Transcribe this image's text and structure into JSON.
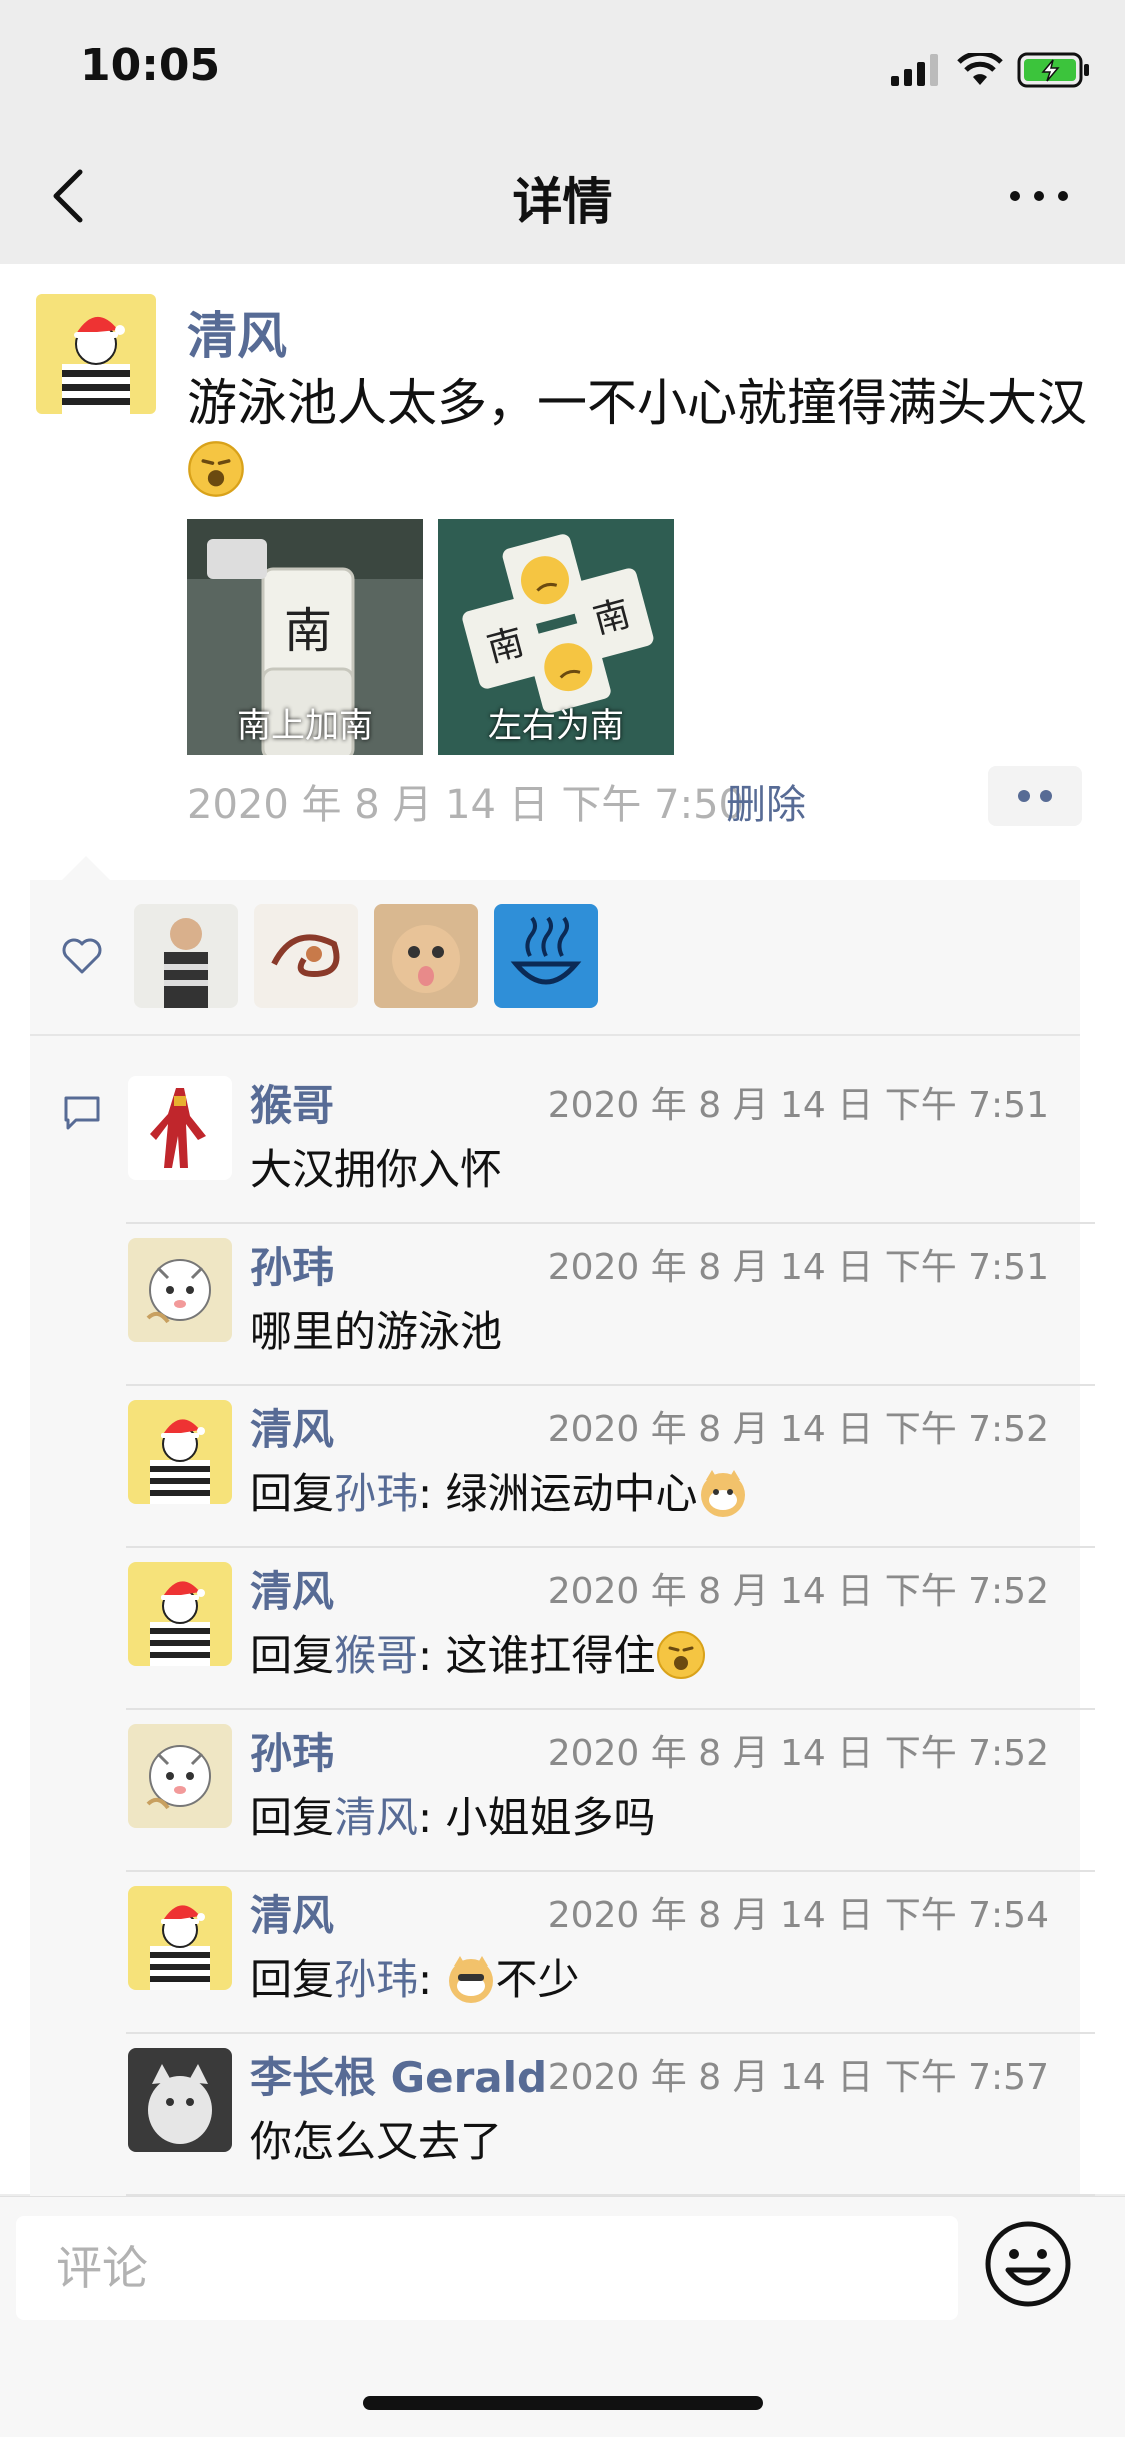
{
  "status_bar": {
    "time": "10:05"
  },
  "nav": {
    "title": "详情"
  },
  "post": {
    "author": "清风",
    "text": "游泳池人太多，一不小心就撞得满头大汉",
    "images": [
      {
        "caption": "南上加南"
      },
      {
        "caption": "左右为南"
      }
    ],
    "time": "2020 年 8 月 14 日  下午 7:50",
    "delete_label": "删除"
  },
  "likes": {
    "users": [
      "user-1",
      "user-2",
      "user-3",
      "user-4"
    ]
  },
  "comments": [
    {
      "name": "猴哥",
      "time": "2020 年 8 月 14 日  下午 7:51",
      "text": "大汉拥你入怀"
    },
    {
      "name": "孙玮",
      "time": "2020 年 8 月 14 日  下午 7:51",
      "text": "哪里的游泳池"
    },
    {
      "name": "清风",
      "time": "2020 年 8 月 14 日  下午 7:52",
      "prefix": "回复",
      "reply_to": "孙玮",
      "text": ": 绿洲运动中心"
    },
    {
      "name": "清风",
      "time": "2020 年 8 月 14 日  下午 7:52",
      "prefix": "回复",
      "reply_to": "猴哥",
      "text": ": 这谁扛得住"
    },
    {
      "name": "孙玮",
      "time": "2020 年 8 月 14 日  下午 7:52",
      "prefix": "回复",
      "reply_to": "清风",
      "text": ": 小姐姐多吗"
    },
    {
      "name": "清风",
      "time": "2020 年 8 月 14 日  下午 7:54",
      "prefix": "回复",
      "reply_to": "孙玮",
      "text": ": ",
      "suffix": "不少"
    },
    {
      "name": "李长根 Gerald",
      "time": "2020 年 8 月 14 日  下午 7:57",
      "text": "你怎么又去了"
    }
  ],
  "input": {
    "placeholder": "评论"
  },
  "colors": {
    "link": "#576b95",
    "background": "#ededed"
  }
}
